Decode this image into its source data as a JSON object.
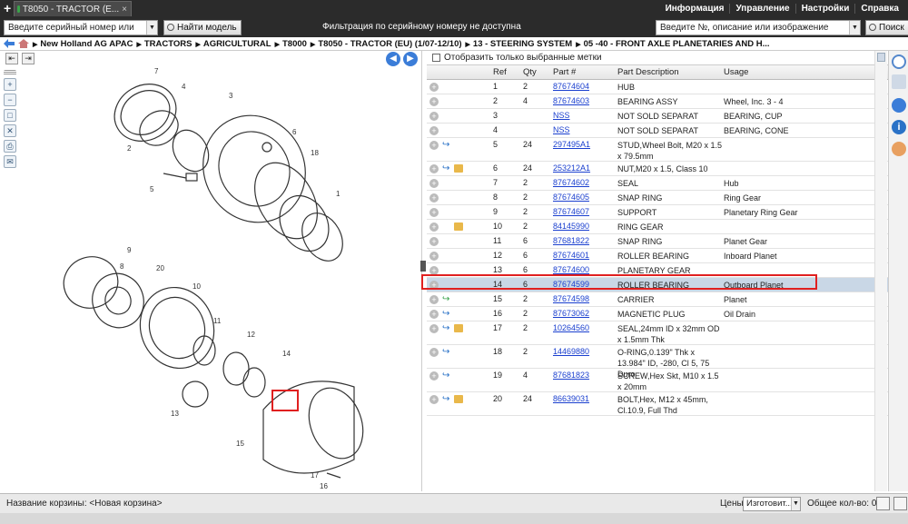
{
  "tabbar": {
    "tab_title": "T8050 - TRACTOR (E...",
    "close": "×"
  },
  "menu": [
    "Информация",
    "Управление",
    "Настройки",
    "Справка"
  ],
  "search": {
    "serial_placeholder": "Введите серийный номер или модель",
    "find_model": "Найти модель",
    "notice": "Фильтрация по серийному номеру не доступна",
    "part_placeholder": "Введите №, описание или изображение детали",
    "search_btn": "Поиск"
  },
  "breadcrumb": [
    "New Holland AG APAC",
    "TRACTORS",
    "AGRICULTURAL",
    "T8000",
    "T8050 - TRACTOR (EU) (1/07-12/10)",
    "13 - STEERING SYSTEM",
    "05 -40 - FRONT AXLE PLANETARIES AND H..."
  ],
  "filter": {
    "label": "Отобразить только выбранные метки"
  },
  "table": {
    "headers": {
      "ref": "Ref",
      "qty": "Qty",
      "part": "Part #",
      "desc": "Part Description",
      "usage": "Usage"
    },
    "rows": [
      {
        "ref": "1",
        "qty": "2",
        "part": "87674604",
        "desc": "HUB",
        "usage": "",
        "icons": ""
      },
      {
        "ref": "2",
        "qty": "4",
        "part": "87674603",
        "desc": "BEARING ASSY",
        "usage": "Wheel, Inc. 3 - 4",
        "icons": ""
      },
      {
        "ref": "3",
        "qty": "",
        "part": "NSS",
        "desc": "NOT SOLD SEPARAT",
        "usage": "BEARING, CUP",
        "icons": ""
      },
      {
        "ref": "4",
        "qty": "",
        "part": "NSS",
        "desc": "NOT SOLD SEPARAT",
        "usage": "BEARING, CONE",
        "icons": ""
      },
      {
        "ref": "5",
        "qty": "24",
        "part": "297495A1",
        "desc": "STUD,Wheel Bolt, M20 x 1.5 x 79.5mm",
        "usage": "",
        "icons": "a"
      },
      {
        "ref": "6",
        "qty": "24",
        "part": "253212A1",
        "desc": "NUT,M20 x 1.5, Class 10",
        "usage": "",
        "icons": "ab"
      },
      {
        "ref": "7",
        "qty": "2",
        "part": "87674602",
        "desc": "SEAL",
        "usage": "Hub",
        "icons": ""
      },
      {
        "ref": "8",
        "qty": "2",
        "part": "87674605",
        "desc": "SNAP RING",
        "usage": "Ring Gear",
        "icons": ""
      },
      {
        "ref": "9",
        "qty": "2",
        "part": "87674607",
        "desc": "SUPPORT",
        "usage": "Planetary Ring Gear",
        "icons": ""
      },
      {
        "ref": "10",
        "qty": "2",
        "part": "84145990",
        "desc": "RING GEAR",
        "usage": "",
        "icons": "b"
      },
      {
        "ref": "11",
        "qty": "6",
        "part": "87681822",
        "desc": "SNAP RING",
        "usage": "Planet Gear",
        "icons": ""
      },
      {
        "ref": "12",
        "qty": "6",
        "part": "87674601",
        "desc": "ROLLER BEARING",
        "usage": "Inboard Planet",
        "icons": ""
      },
      {
        "ref": "13",
        "qty": "6",
        "part": "87674600",
        "desc": "PLANETARY GEAR",
        "usage": "",
        "icons": ""
      },
      {
        "ref": "14",
        "qty": "6",
        "part": "87674599",
        "desc": "ROLLER BEARING",
        "usage": "Outboard Planet",
        "icons": "",
        "selected": true
      },
      {
        "ref": "15",
        "qty": "2",
        "part": "87674598",
        "desc": "CARRIER",
        "usage": "Planet",
        "icons": "g"
      },
      {
        "ref": "16",
        "qty": "2",
        "part": "87673062",
        "desc": "MAGNETIC PLUG",
        "usage": "Oil Drain",
        "icons": "a"
      },
      {
        "ref": "17",
        "qty": "2",
        "part": "10264560",
        "desc": "SEAL,24mm ID x 32mm OD x 1.5mm Thk",
        "usage": "",
        "icons": "ab"
      },
      {
        "ref": "18",
        "qty": "2",
        "part": "14469880",
        "desc": "O-RING,0.139\" Thk x 13.984\" ID, -280, Cl 5, 75 Duro",
        "usage": "",
        "icons": "a"
      },
      {
        "ref": "19",
        "qty": "4",
        "part": "87681823",
        "desc": "SCREW,Hex Skt, M10 x 1.5 x 20mm",
        "usage": "",
        "icons": "a"
      },
      {
        "ref": "20",
        "qty": "24",
        "part": "86639031",
        "desc": "BOLT,Hex, M12 x 45mm, Cl.10.9, Full Thd",
        "usage": "",
        "icons": "ab"
      }
    ]
  },
  "diagram_labels": [
    "7",
    "4",
    "2",
    "3",
    "6",
    "18",
    "5",
    "1",
    "9",
    "8",
    "20",
    "10",
    "11",
    "12",
    "14",
    "13",
    "15",
    "17",
    "16"
  ],
  "bottom": {
    "cart_label": "Название корзины:",
    "cart_value": "<Новая корзина>",
    "prices_label": "Цены:",
    "prices_value": "Изготовит...",
    "total_label": "Общее кол-во: 0"
  }
}
